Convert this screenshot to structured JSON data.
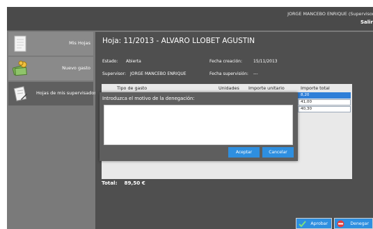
{
  "header": {
    "user": "JORGE MANCEBO ENRIQUE (Supervisor)",
    "logout": "Salir"
  },
  "sidebar": {
    "items": [
      {
        "label": "Mis Hojas",
        "icon": "document-icon"
      },
      {
        "label": "Nuevo gasto",
        "icon": "money-icon"
      },
      {
        "label": "Hojas de mis supervisados",
        "icon": "supervised-sheets-icon"
      }
    ]
  },
  "sheet": {
    "title": "Hoja:  11/2013 - ALVARO LLOBET AGUSTIN",
    "estado_label": "Estado:",
    "estado_value": "Abierta",
    "fecha_creacion_label": "Fecha creación:",
    "fecha_creacion_value": "15/11/2013",
    "supervisor_label": "Supervisor:",
    "supervisor_value": "JORGE MANCEBO ENRIQUE",
    "fecha_supervision_label": "Fecha supervisión:",
    "fecha_supervision_value": "---"
  },
  "table": {
    "columns": [
      "Tipo de gasto",
      "Unidades",
      "Importe unitario",
      "Importe total"
    ],
    "totals": [
      "8,20",
      "41,00",
      "40,30"
    ]
  },
  "total": {
    "label": "Total:",
    "value": "89,50 €"
  },
  "actions": {
    "approve": "Aprobar",
    "deny": "Denegar"
  },
  "dialog": {
    "title": "Introduzca el motivo de la denegación:",
    "reason_value": "",
    "accept": "Aceptar",
    "cancel": "Cancelar"
  },
  "colors": {
    "accent": "#2e8fe0",
    "panel": "#4f4f4f",
    "topbar": "#4a4a4a"
  }
}
